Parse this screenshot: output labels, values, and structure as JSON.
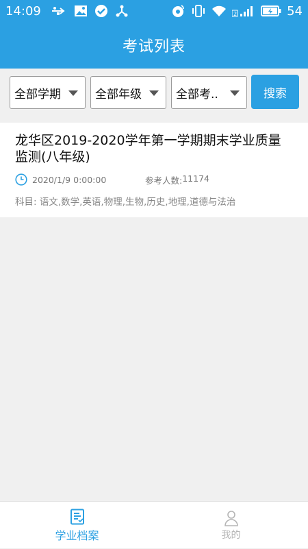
{
  "status_bar": {
    "time": "14:09",
    "battery_level": "54",
    "icons_left": [
      "usb-icon",
      "image-icon",
      "check-circle-icon",
      "share-icon"
    ],
    "icons_right": [
      "nfc-icon",
      "vibrate-icon",
      "wifi-icon",
      "sim-signal-icon",
      "battery-charging-icon"
    ]
  },
  "header": {
    "title": "考试列表"
  },
  "filters": {
    "semester": "全部学期",
    "grade": "全部年级",
    "exam": "全部考..",
    "search_label": "搜索"
  },
  "exams": [
    {
      "title": "龙华区2019-2020学年第一学期期末学业质量监测(八年级)",
      "date": "2020/1/9 0:00:00",
      "count_label": "参考人数: ",
      "count": "11174",
      "subjects_label": "科目: ",
      "subjects": "语文,数学,英语,物理,生物,历史,地理,道德与法治"
    }
  ],
  "bottom_nav": {
    "items": [
      {
        "label": "学业档案",
        "icon": "document-icon",
        "active": true
      },
      {
        "label": "我的",
        "icon": "person-icon",
        "active": false
      }
    ]
  },
  "colors": {
    "primary": "#2ba0e2",
    "background": "#f0f0f0",
    "inactive": "#b5b5b5"
  }
}
